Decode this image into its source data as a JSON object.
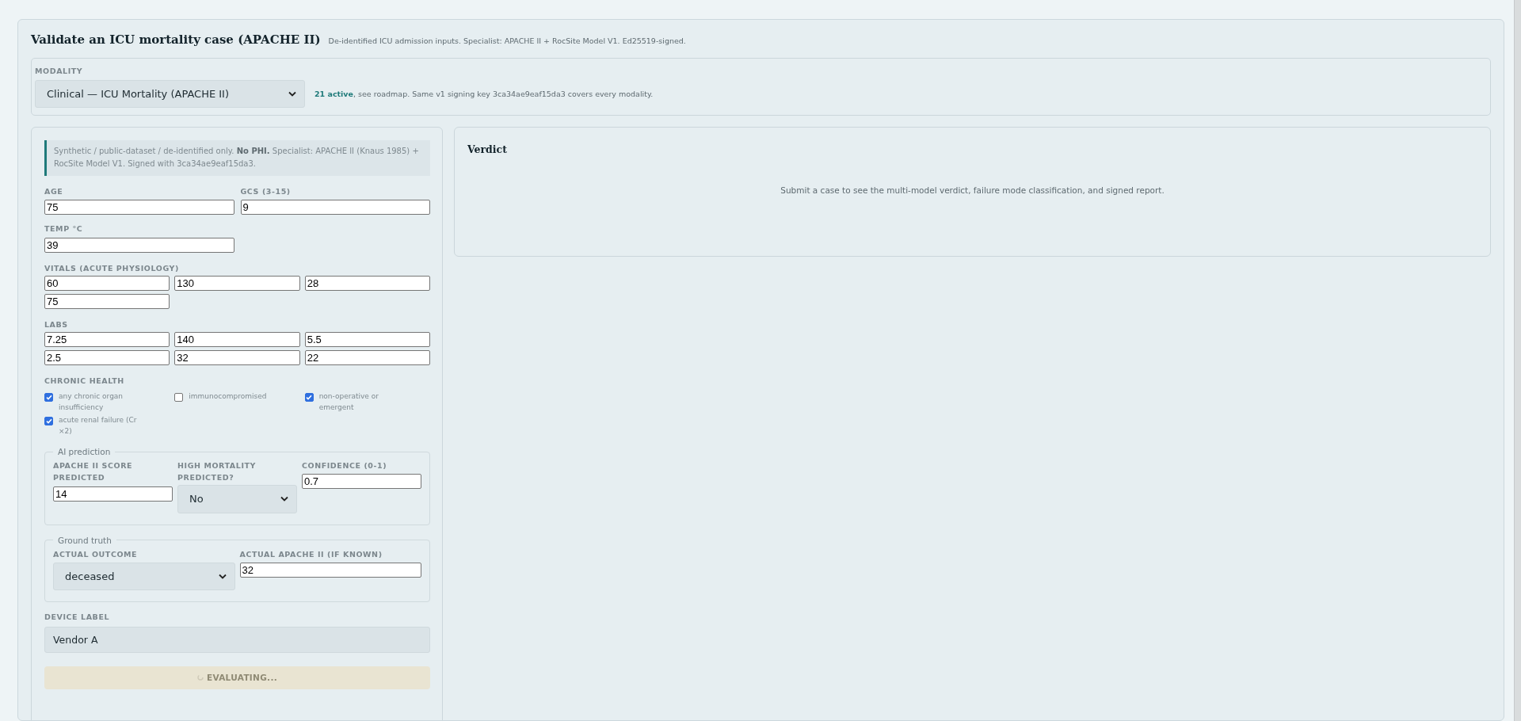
{
  "header": {
    "title": "Validate an ICU mortality case (APACHE II)",
    "subtitle": "De-identified ICU admission inputs. Specialist: APACHE II + RocSite Model V1. Ed25519-signed."
  },
  "modality": {
    "label": "MODALITY",
    "value": "Clinical — ICU Mortality (APACHE II)",
    "note": "**21 active**, see roadmap. Same v1 signing key 3ca34ae9eaf15da3 covers every modality."
  },
  "form": {
    "notice": "Synthetic / public-dataset / de-identified only. **No PHI.** Specialist: APACHE II (Knaus 1985) + RocSite Model V1. Signed with 3ca34ae9eaf15da3.",
    "basic_fields": [
      {
        "label": "AGE",
        "value": "75"
      },
      {
        "label": "GCS (3-15)",
        "value": "9"
      },
      {
        "label": "TEMP °C",
        "value": "39"
      }
    ],
    "vitals": {
      "label": "VITALS (ACUTE PHYSIOLOGY)",
      "values": [
        "60",
        "130",
        "28",
        "75"
      ]
    },
    "labs": {
      "label": "LABS",
      "values": [
        "7.25",
        "140",
        "5.5",
        "2.5",
        "32",
        "22"
      ]
    },
    "chronic_health": {
      "label": "CHRONIC HEALTH",
      "items": [
        {
          "label": "any chronic organ insufficiency",
          "checked": true
        },
        {
          "label": "immunocompromised",
          "checked": false
        },
        {
          "label": "non-operative or emergent",
          "checked": true
        },
        {
          "label": "acute renal failure (Cr ×2)",
          "checked": true
        }
      ]
    },
    "ai_prediction": {
      "legend": "AI prediction",
      "fields": [
        {
          "kind": "input",
          "label": "APACHE II SCORE PREDICTED",
          "value": "14"
        },
        {
          "kind": "select",
          "label": "HIGH MORTALITY PREDICTED?",
          "value": "No"
        },
        {
          "kind": "input",
          "label": "CONFIDENCE (0-1)",
          "value": "0.7"
        }
      ]
    },
    "ground_truth": {
      "legend": "Ground truth",
      "fields": [
        {
          "kind": "select",
          "label": "ACTUAL OUTCOME",
          "value": "deceased"
        },
        {
          "kind": "input",
          "label": "ACTUAL APACHE II (IF KNOWN)",
          "value": "32"
        }
      ]
    },
    "device": {
      "label": "DEVICE LABEL",
      "value": "Vendor A"
    },
    "submit": {
      "label": "EVALUATING...",
      "disabled": true
    }
  },
  "verdict": {
    "title": "Verdict",
    "empty_message": "Submit a case to see the multi-model verdict, failure mode classification, and signed report."
  }
}
